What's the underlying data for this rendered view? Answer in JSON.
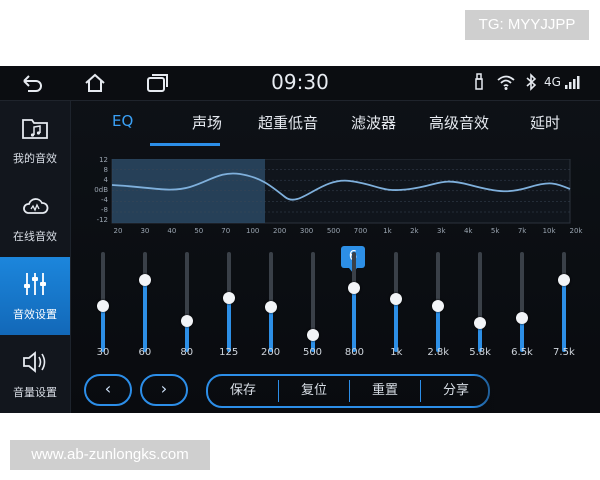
{
  "watermark_top": "TG: MYYJJPP",
  "watermark_bottom": "www.ab-zunlongks.com",
  "status": {
    "time": "09:30",
    "network": "4G"
  },
  "sidebar": [
    {
      "label": "我的音效",
      "icon": "music-folder-icon",
      "active": false
    },
    {
      "label": "在线音效",
      "icon": "cloud-icon",
      "active": false
    },
    {
      "label": "音效设置",
      "icon": "sliders-icon",
      "active": true
    },
    {
      "label": "音量设置",
      "icon": "speaker-icon",
      "active": false
    }
  ],
  "tabs": [
    "EQ",
    "声场",
    "超重低音",
    "滤波器",
    "高级音效",
    "延时"
  ],
  "active_tab": "EQ",
  "curve": {
    "y_labels": [
      "12",
      "8",
      "4",
      "0dB",
      "-4",
      "-8",
      "-12"
    ],
    "x_labels": [
      "20",
      "30",
      "40",
      "50",
      "70",
      "100",
      "200",
      "300",
      "500",
      "700",
      "1k",
      "2k",
      "3k",
      "4k",
      "5k",
      "7k",
      "10k",
      "20k"
    ]
  },
  "eq_bands": [
    {
      "freq": "30",
      "level": 0.45
    },
    {
      "freq": "60",
      "level": 0.75
    },
    {
      "freq": "80",
      "level": 0.28
    },
    {
      "freq": "125",
      "level": 0.55
    },
    {
      "freq": "200",
      "level": 0.44
    },
    {
      "freq": "500",
      "level": 0.12
    },
    {
      "freq": "800",
      "level": 0.66
    },
    {
      "freq": "1k",
      "level": 0.53
    },
    {
      "freq": "2.8k",
      "level": 0.46
    },
    {
      "freq": "5.8k",
      "level": 0.26
    },
    {
      "freq": "6.5k",
      "level": 0.32
    },
    {
      "freq": "7.5k",
      "level": 0.75
    }
  ],
  "selected_band_value": "6",
  "buttons": {
    "prev": "‹",
    "next": "›",
    "save": "保存",
    "reset": "复位",
    "reset2": "重置",
    "more": "分享"
  }
}
